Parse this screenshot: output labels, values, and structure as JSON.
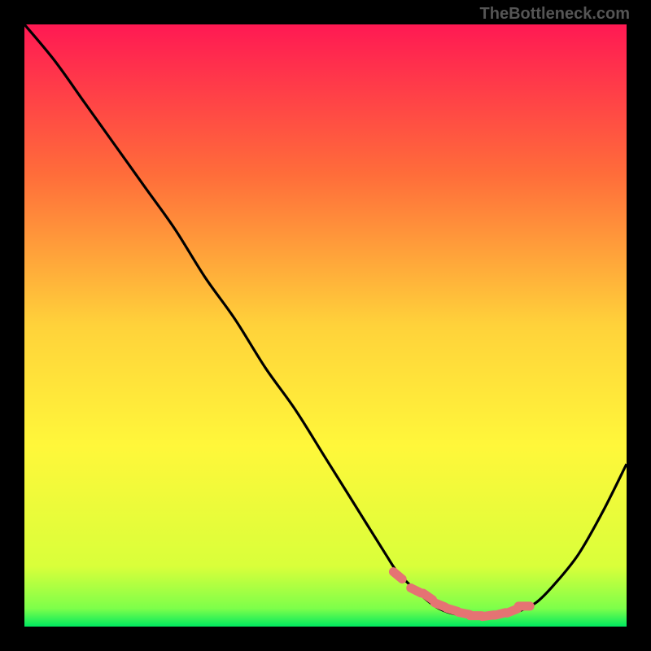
{
  "watermark": "TheBottleneck.com",
  "chart_data": {
    "type": "line",
    "title": "",
    "xlabel": "",
    "ylabel": "",
    "xlim": [
      0,
      100
    ],
    "ylim": [
      0,
      100
    ],
    "background_gradient": {
      "stops": [
        {
          "offset": 0,
          "color": "#ff1953"
        },
        {
          "offset": 25,
          "color": "#ff6d3a"
        },
        {
          "offset": 50,
          "color": "#ffd23a"
        },
        {
          "offset": 70,
          "color": "#fff73a"
        },
        {
          "offset": 90,
          "color": "#d9ff3a"
        },
        {
          "offset": 97,
          "color": "#7dff4a"
        },
        {
          "offset": 100,
          "color": "#00e85f"
        }
      ]
    },
    "series": [
      {
        "name": "bottleneck-curve",
        "color": "#000000",
        "x": [
          0,
          5,
          10,
          15,
          20,
          25,
          30,
          35,
          40,
          45,
          50,
          55,
          60,
          62,
          65,
          68,
          70,
          72,
          75,
          78,
          80,
          82,
          85,
          88,
          92,
          96,
          100
        ],
        "values": [
          100,
          94,
          87,
          80,
          73,
          66,
          58,
          51,
          43,
          36,
          28,
          20,
          12,
          9,
          6,
          3.5,
          2.5,
          2,
          1.7,
          1.7,
          2,
          2.5,
          4,
          7,
          12,
          19,
          27
        ]
      }
    ],
    "markers": {
      "name": "highlight-dots",
      "color": "#e57373",
      "x": [
        62,
        65,
        67,
        69,
        71,
        73,
        75,
        77,
        79,
        81,
        83
      ],
      "values": [
        8.5,
        6,
        5,
        3.6,
        2.8,
        2.2,
        1.8,
        1.8,
        2.1,
        2.6,
        3.4
      ]
    }
  }
}
